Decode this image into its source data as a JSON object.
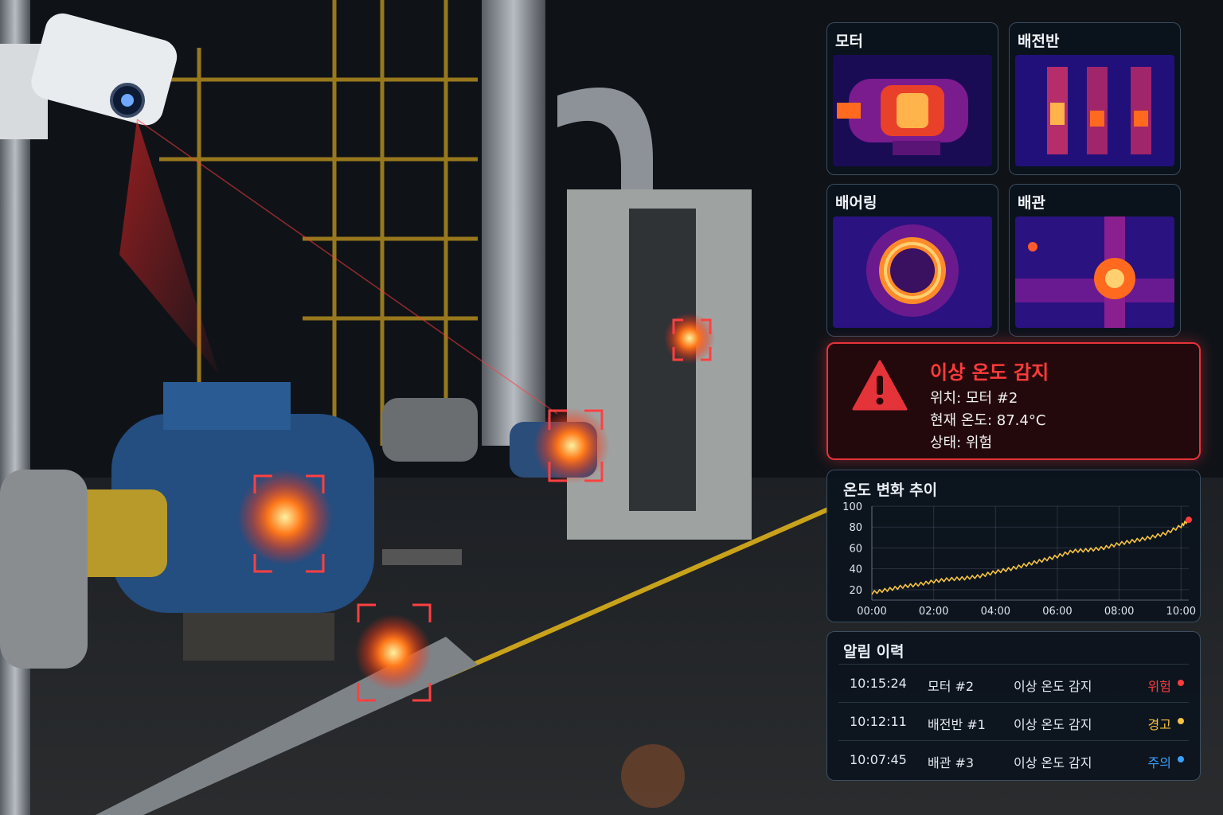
{
  "thermal_cards": [
    {
      "title": "모터",
      "icon": "motor-thermal-icon"
    },
    {
      "title": "배전반",
      "icon": "switchboard-thermal-icon"
    },
    {
      "title": "배어링",
      "icon": "bearing-thermal-icon"
    },
    {
      "title": "배관",
      "icon": "pipe-thermal-icon"
    }
  ],
  "alert": {
    "title": "이상 온도 감지",
    "location": "위치: 모터 #2",
    "temperature": "현재 온도: 87.4°C",
    "status": "상태: 위험",
    "icon": "warning-triangle-icon",
    "color": "#e5333a"
  },
  "trend": {
    "title": "온도 변화 추이"
  },
  "chart_data": {
    "type": "line",
    "title": "온도 변화 추이",
    "xlabel": "",
    "ylabel": "",
    "x_ticks": [
      "00:00",
      "02:00",
      "04:00",
      "06:00",
      "08:00",
      "10:00"
    ],
    "y_ticks": [
      "20",
      "40",
      "60",
      "80",
      "100"
    ],
    "ylim": [
      10,
      100
    ],
    "xlim": [
      0,
      10.25
    ],
    "grid": true,
    "series": [
      {
        "color": "#f5c242",
        "x": [
          0,
          0.5,
          1,
          1.5,
          2,
          2.5,
          3,
          3.5,
          4,
          4.5,
          5,
          5.5,
          6,
          6.5,
          7,
          7.5,
          8,
          8.5,
          9,
          9.5,
          10,
          10.25
        ],
        "y": [
          17,
          20,
          23,
          25,
          28,
          30,
          31,
          33,
          37,
          40,
          44,
          48,
          52,
          57,
          58,
          60,
          64,
          67,
          70,
          74,
          81,
          87
        ]
      }
    ],
    "highlight_point": {
      "x": 10.25,
      "y": 87,
      "color": "#ff3b3b"
    }
  },
  "history": {
    "title": "알림 이력",
    "rows": [
      {
        "time": "10:15:24",
        "location": "모터 #2",
        "event": "이상 온도 감지",
        "level": "위험",
        "color": "#ff3b3b"
      },
      {
        "time": "10:12:11",
        "location": "배전반 #1",
        "event": "이상 온도 감지",
        "level": "경고",
        "color": "#f5c242"
      },
      {
        "time": "10:07:45",
        "location": "배관 #3",
        "event": "이상 온도 감지",
        "level": "주의",
        "color": "#3aa0ff"
      }
    ]
  }
}
